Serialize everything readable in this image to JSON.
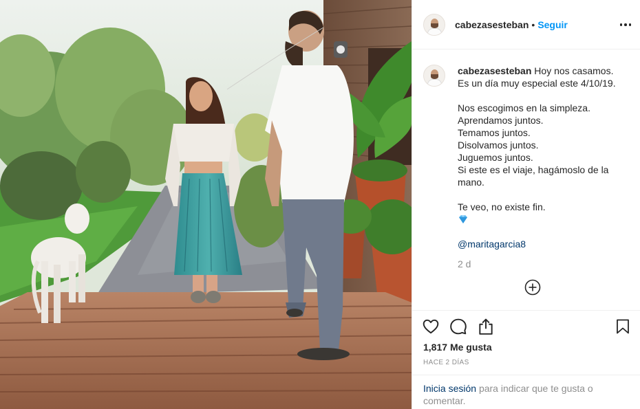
{
  "post": {
    "username": "cabezasesteban",
    "separator": "•",
    "follow_label": "Seguir",
    "more_icon": "more-horizontal-icon"
  },
  "caption": {
    "username": "cabezasesteban",
    "lines": [
      "Hoy nos casamos.",
      "Es un día muy especial este 4/10/19.",
      "",
      "Nos escogimos en la simpleza.",
      "Aprendamos juntos.",
      "Temamos juntos.",
      "Disolvamos juntos.",
      "Juguemos juntos.",
      "Si este es el viaje, hagámoslo de la mano.",
      "",
      "Te veo, no existe fin."
    ],
    "emoji_icon": "blue-diamond-icon",
    "mention": "@maritagarcia8",
    "age": "2 d"
  },
  "actions": {
    "icons": [
      "heart-icon",
      "comment-icon",
      "share-icon",
      "bookmark-icon"
    ],
    "likes_count": "1,817",
    "likes_label": "Me gusta",
    "timestamp": "HACE 2 DÍAS"
  },
  "login_prompt": {
    "link": "Inicia sesión",
    "text": "para indicar que te gusta o comentar."
  },
  "colors": {
    "accent": "#0095f6",
    "link": "#00376b",
    "muted": "#8e8e8e",
    "text": "#262626"
  }
}
